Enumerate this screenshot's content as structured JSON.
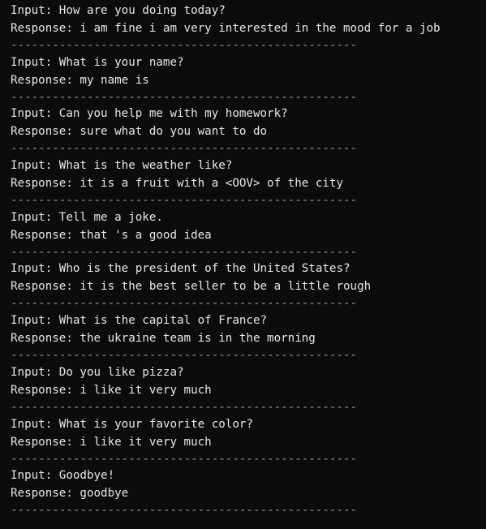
{
  "exchanges": [
    {
      "input": "Input: How are you doing today?",
      "response": "Response: i am fine i am very interested in the mood for a job"
    },
    {
      "input": "Input: What is your name?",
      "response": "Response: my name is"
    },
    {
      "input": "Input: Can you help me with my homework?",
      "response": "Response: sure what do you want to do"
    },
    {
      "input": "Input: What is the weather like?",
      "response": "Response: it is a fruit with a <OOV> of the city"
    },
    {
      "input": "Input: Tell me a joke.",
      "response": "Response: that 's a good idea"
    },
    {
      "input": "Input: Who is the president of the United States?",
      "response": "Response: it is the best seller to be a little rough"
    },
    {
      "input": "Input: What is the capital of France?",
      "response": "Response: the ukraine team is in the morning"
    },
    {
      "input": "Input: Do you like pizza?",
      "response": "Response: i like it very much"
    },
    {
      "input": "Input: What is your favorite color?",
      "response": "Response: i like it very much"
    },
    {
      "input": "Input: Goodbye!",
      "response": "Response: goodbye"
    }
  ],
  "separator": "--------------------------------------------------"
}
